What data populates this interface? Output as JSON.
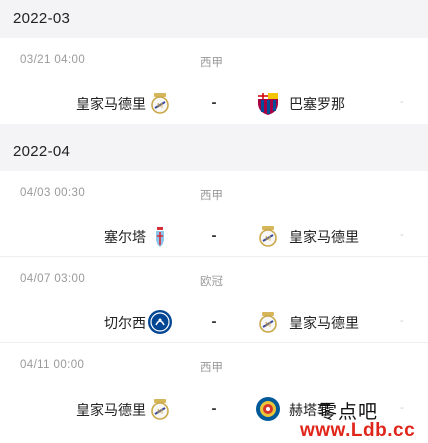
{
  "months": [
    {
      "label": "2022-03",
      "matches": [
        {
          "datetime": "03/21 04:00",
          "league": "西甲",
          "home": "皇家马德里",
          "home_icon": "real-madrid-crest-icon",
          "vs": "-",
          "away": "巴塞罗那",
          "away_icon": "barcelona-crest-icon",
          "score": "-"
        }
      ]
    },
    {
      "label": "2022-04",
      "matches": [
        {
          "datetime": "04/03 00:30",
          "league": "西甲",
          "home": "塞尔塔",
          "home_icon": "celta-crest-icon",
          "vs": "-",
          "away": "皇家马德里",
          "away_icon": "real-madrid-crest-icon",
          "score": "-"
        },
        {
          "datetime": "04/07 03:00",
          "league": "欧冠",
          "home": "切尔西",
          "home_icon": "chelsea-crest-icon",
          "vs": "-",
          "away": "皇家马德里",
          "away_icon": "real-madrid-crest-icon",
          "score": "-"
        },
        {
          "datetime": "04/11 00:00",
          "league": "西甲",
          "home": "皇家马德里",
          "home_icon": "real-madrid-crest-icon",
          "vs": "-",
          "away": "赫塔菲",
          "away_icon": "getafe-crest-icon",
          "score": "-"
        }
      ]
    }
  ],
  "watermark": {
    "text": "零点吧",
    "url": "www.Ldb.cc",
    "color": "#e0261b"
  },
  "colors": {
    "background": "#f4f4f6",
    "card": "#ffffff",
    "meta_text": "#9a9a9a",
    "primary_text": "#222222"
  }
}
